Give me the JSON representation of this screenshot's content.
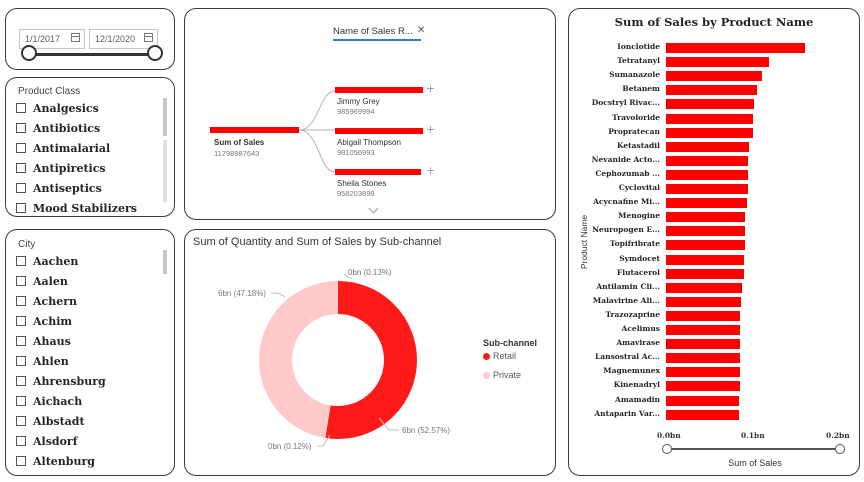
{
  "date_slicer": {
    "start": "1/1/2017",
    "end": "12/1/2020",
    "range_low": 0,
    "range_high": 1
  },
  "product_class": {
    "title": "Product Class",
    "items": [
      "Analgesics",
      "Antibiotics",
      "Antimalarial",
      "Antipiretics",
      "Antiseptics",
      "Mood Stabilizers"
    ]
  },
  "city": {
    "title": "City",
    "items": [
      "Aachen",
      "Aalen",
      "Achern",
      "Achim",
      "Ahaus",
      "Ahlen",
      "Ahrensburg",
      "Aichach",
      "Albstadt",
      "Alsdorf",
      "Altenburg"
    ]
  },
  "decomp": {
    "column_header": "Name of Sales R...",
    "root_label": "Sum of Sales",
    "root_value": "11798987643",
    "children": [
      {
        "name": "Jimmy Grey",
        "value": "985969994"
      },
      {
        "name": "Abigail Thompson",
        "value": "981056993"
      },
      {
        "name": "Sheila Stones",
        "value": "958203898"
      }
    ]
  },
  "donut": {
    "title": "Sum of Quantity and Sum of Sales by Sub-channel",
    "legend_title": "Sub-channel",
    "legend": [
      {
        "name": "Retail",
        "color": "#ff1a1a"
      },
      {
        "name": "Private",
        "color": "#ffc9c9"
      }
    ],
    "labels": {
      "retail_sales": "6bn (52.57%)",
      "private_sales": "6bn (47.18%)",
      "top_small": "0bn (0.13%)",
      "bottom_small": "0bn (0.12%)"
    }
  },
  "chart_data": {
    "type": "bar",
    "title": "Sum of Sales by Product Name",
    "xlabel": "Sum of Sales",
    "ylabel": "Product Name",
    "xlim": [
      0,
      0.2
    ],
    "x_ticks": [
      "0.0bn",
      "0.1bn",
      "0.2bn"
    ],
    "categories": [
      "Ionclotide",
      "Tetratanyl",
      "Sumanazole",
      "Betanem",
      "Docstryl Rivac...",
      "Travoloride",
      "Propratecan",
      "Ketastadil",
      "Nevanide Acto...",
      "Cephozumab ...",
      "Cyclovital",
      "Acycnafine Mi...",
      "Menogine",
      "Neuropogen E...",
      "Topifribrate",
      "Symdocet",
      "Flutacerol",
      "Antilamin Cli...",
      "Malavirine Ali...",
      "Trazozaprine",
      "Acelimus",
      "Amavirase",
      "Lansostral Ac...",
      "Magnemunex",
      "Kinenadryl",
      "Amamadin",
      "Antaparin Var..."
    ],
    "values": [
      0.164,
      0.121,
      0.113,
      0.107,
      0.104,
      0.102,
      0.102,
      0.098,
      0.097,
      0.096,
      0.096,
      0.095,
      0.093,
      0.093,
      0.093,
      0.092,
      0.092,
      0.089,
      0.088,
      0.087,
      0.087,
      0.087,
      0.087,
      0.087,
      0.087,
      0.086,
      0.086
    ],
    "color": "#ff0000"
  }
}
